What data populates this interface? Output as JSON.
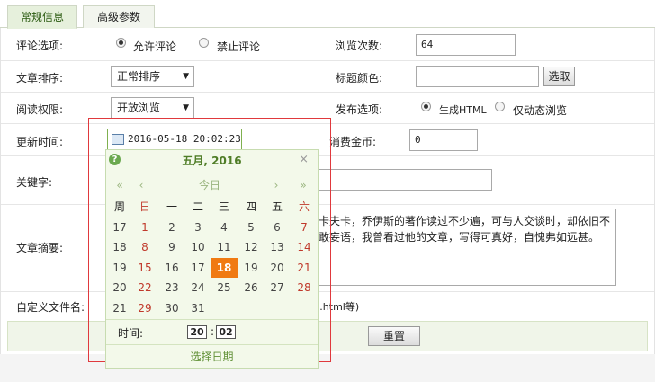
{
  "tabs": [
    {
      "label": "常规信息",
      "active": true
    },
    {
      "label": "高级参数",
      "active": false
    }
  ],
  "form": {
    "comment_label": "评论选项:",
    "comment_allow": "允许评论",
    "comment_deny": "禁止评论",
    "views_label": "浏览次数:",
    "views_value": "64",
    "sort_label": "文章排序:",
    "sort_value": "正常排序",
    "title_color_label": "标题颜色:",
    "title_color_value": "",
    "pick_button": "选取",
    "read_perm_label": "阅读权限:",
    "read_perm_value": "开放浏览",
    "publish_label": "发布选项:",
    "publish_html": "生成HTML",
    "publish_dynamic": "仅动态浏览",
    "update_time_label": "更新时间:",
    "update_time_value": "2016-05-18 20:02:23",
    "gold_label": "消费金币:",
    "gold_value": "0",
    "keywords_label": "关键字:",
    "summary_label": "文章摘要:",
    "summary_line1": "卡夫卡，乔伊斯的著作读过不少遍，可与人交谈时，却依旧不",
    "summary_line2": "敢妄语，我曾看过他的文章，写得可真好，自愧弗如远甚。",
    "filename_label": "自定义文件名:",
    "filename_hint": "].html等)",
    "reset_button": "重置"
  },
  "calendar": {
    "title": "五月, 2016",
    "help_icon": "?",
    "close": "×",
    "nav_prev_year": "«",
    "nav_prev_month": "‹",
    "today": "今日",
    "nav_next_month": "›",
    "nav_next_year": "»",
    "weekdays": [
      "周",
      "日",
      "一",
      "二",
      "三",
      "四",
      "五",
      "六"
    ],
    "weeks": [
      {
        "wk": "17",
        "days": [
          "1",
          "2",
          "3",
          "4",
          "5",
          "6",
          "7"
        ]
      },
      {
        "wk": "18",
        "days": [
          "8",
          "9",
          "10",
          "11",
          "12",
          "13",
          "14"
        ]
      },
      {
        "wk": "19",
        "days": [
          "15",
          "16",
          "17",
          "18",
          "19",
          "20",
          "21"
        ]
      },
      {
        "wk": "20",
        "days": [
          "22",
          "23",
          "24",
          "25",
          "26",
          "27",
          "28"
        ]
      },
      {
        "wk": "21",
        "days": [
          "29",
          "30",
          "31",
          "",
          "",
          "",
          ""
        ]
      }
    ],
    "selected_day": "18",
    "time_label": "时间:",
    "hour": "20",
    "minute": "02",
    "time_sep": ":",
    "select_date": "选择日期"
  },
  "colors": {
    "accent_green": "#4f7d27",
    "today_orange": "#f07a12",
    "weekend_red": "#c0392b",
    "highlight_red": "#e0393d"
  }
}
